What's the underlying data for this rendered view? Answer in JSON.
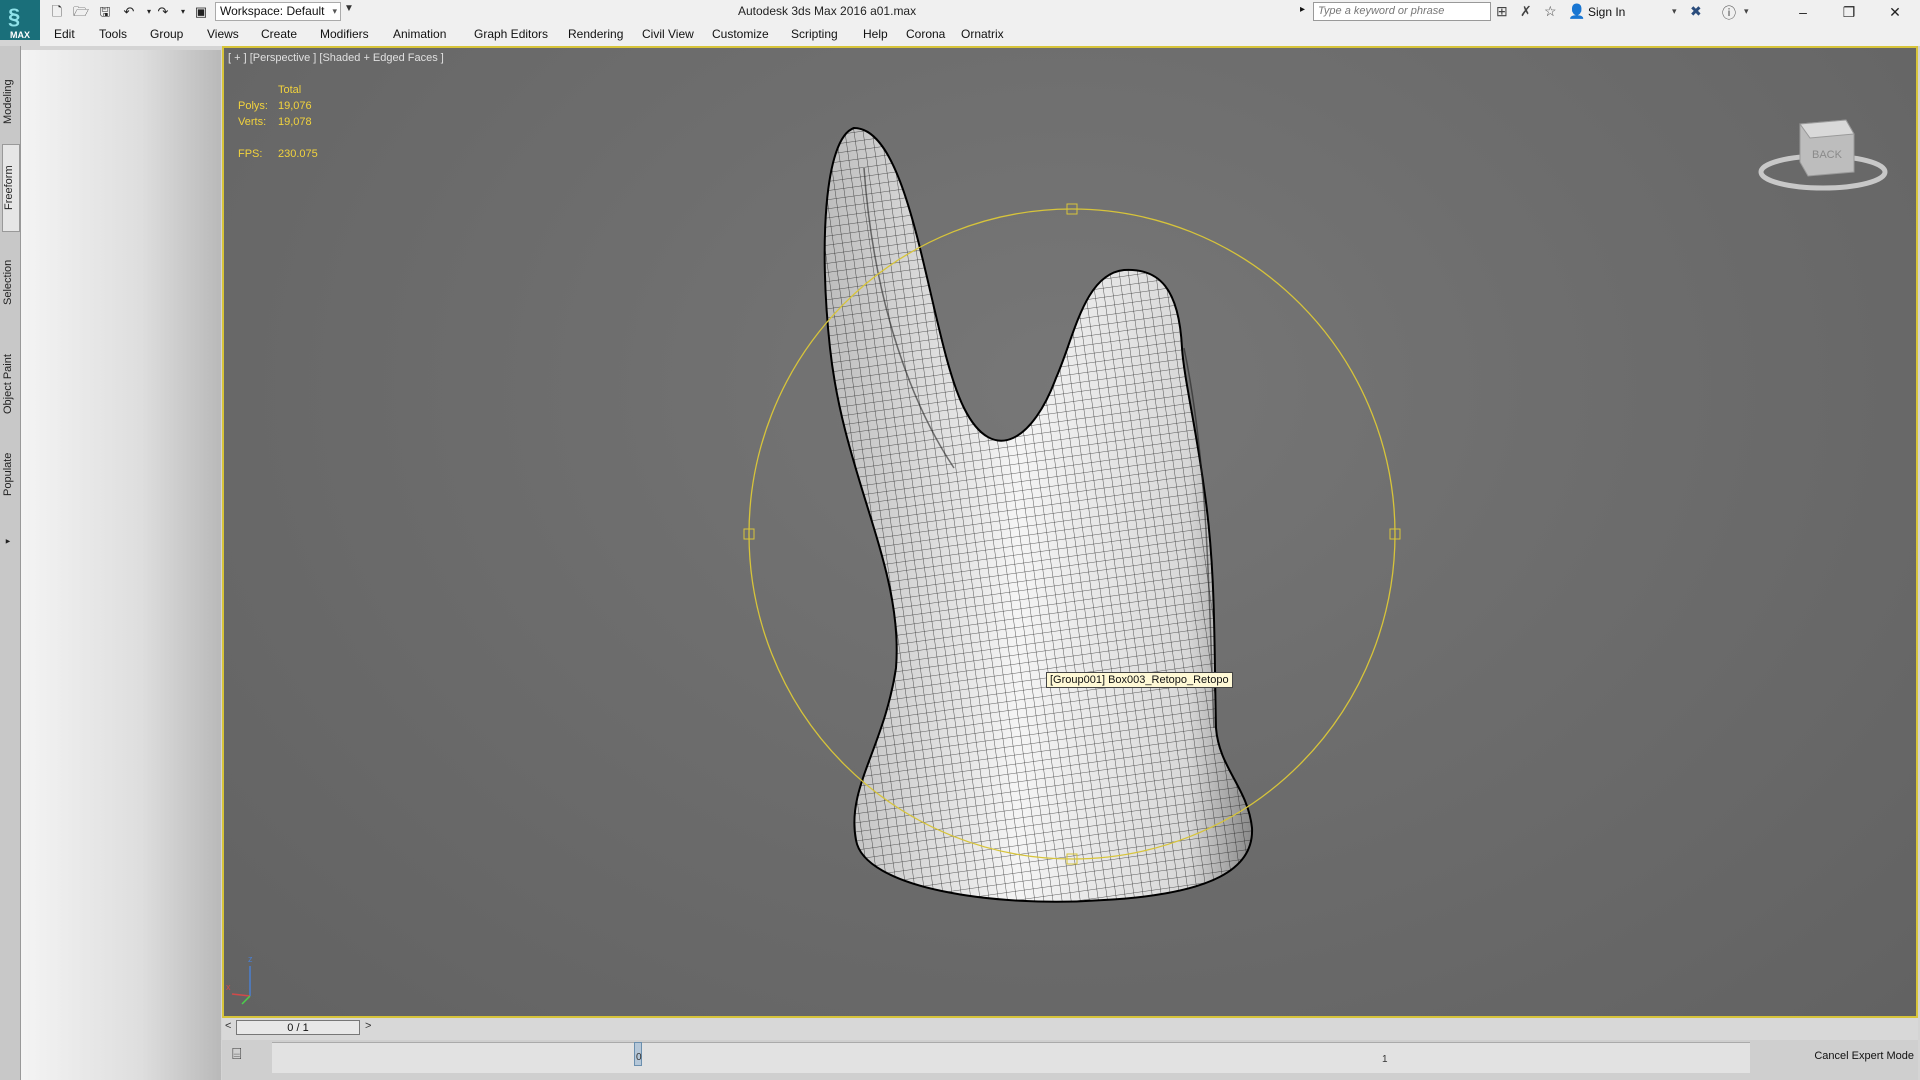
{
  "titlebar": {
    "app_logo_label": "MAX",
    "workspace": "Workspace: Default",
    "title": "Autodesk 3ds Max 2016     a01.max",
    "search_placeholder": "Type a keyword or phrase",
    "signin": "Sign In"
  },
  "menu": [
    "Edit",
    "Tools",
    "Group",
    "Views",
    "Create",
    "Modifiers",
    "Animation",
    "Graph Editors",
    "Rendering",
    "Civil View",
    "Customize",
    "Scripting",
    "Help",
    "Corona",
    "Ornatrix"
  ],
  "left_tabs": [
    "Modeling",
    "Freeform",
    "Selection",
    "Object Paint",
    "Populate"
  ],
  "viewport": {
    "label": "[ + ] [Perspective ] [Shaded + Edged Faces ]",
    "stats_header": "Total",
    "polys_label": "Polys:",
    "polys_value": "19,076",
    "verts_label": "Verts:",
    "verts_value": "19,078",
    "fps_label": "FPS:",
    "fps_value": "230.075",
    "tooltip": "[Group001] Box003_Retopo_Retopo",
    "viewcube_label": "BACK",
    "axis_x": "x",
    "axis_z": "z"
  },
  "timeline": {
    "frame": "0 / 1",
    "marker_0": "0",
    "marker_1": "1",
    "cancel_expert": "Cancel Expert Mode"
  },
  "colors": {
    "selection": "#d7c43a",
    "stats_text": "#f2d33d",
    "viewport_bg": "#6e6e6e"
  }
}
